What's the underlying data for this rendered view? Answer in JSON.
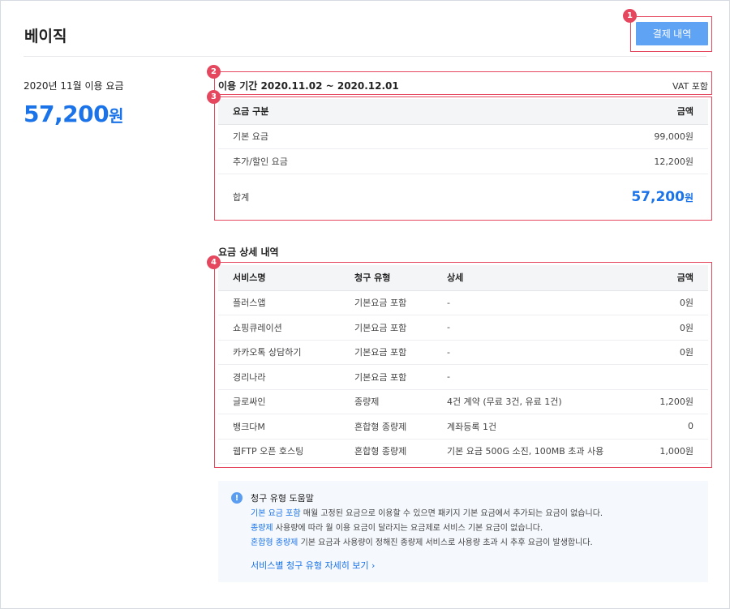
{
  "header": {
    "plan_name": "베이직",
    "pay_history_button": "결제 내역"
  },
  "summary": {
    "usage_label": "2020년 11월 이용 요금",
    "usage_amount": "57,200",
    "usage_unit": "원"
  },
  "period": {
    "label": "이용 기간 2020.11.02 ~ 2020.12.01",
    "vat": "VAT 포함"
  },
  "fee_table": {
    "headers": {
      "type": "요금 구분",
      "amount": "금액"
    },
    "rows": [
      {
        "name": "기본 요금",
        "amount": "99,000원"
      },
      {
        "name": "추가/할인 요금",
        "amount": "12,200원"
      }
    ],
    "total_label": "합계",
    "total_amount": "57,200",
    "total_unit": "원"
  },
  "detail": {
    "title": "요금 상세 내역",
    "headers": {
      "service": "서비스명",
      "billing_type": "청구 유형",
      "detail": "상세",
      "amount": "금액"
    },
    "rows": [
      {
        "service": "플러스앱",
        "billing_type": "기본요금 포함",
        "detail": "-",
        "amount": "0원"
      },
      {
        "service": "쇼핑큐레이션",
        "billing_type": "기본요금 포함",
        "detail": "-",
        "amount": "0원"
      },
      {
        "service": "카카오톡 상담하기",
        "billing_type": "기본요금 포함",
        "detail": "-",
        "amount": "0원"
      },
      {
        "service": "경리나라",
        "billing_type": "기본요금 포함",
        "detail": "-",
        "amount": ""
      },
      {
        "service": "글로싸인",
        "billing_type": "종량제",
        "detail": "4건 계약 (무료 3건, 유료 1건)",
        "amount": "1,200원"
      },
      {
        "service": "뱅크다M",
        "billing_type": "혼합형 종량제",
        "detail": "계좌등록 1건",
        "amount": "0"
      },
      {
        "service": "웹FTP 오픈 호스팅",
        "billing_type": "혼합형 종량제",
        "detail": "기본 요금 500G 소진, 100MB 초과 사용",
        "amount": "1,000원"
      }
    ]
  },
  "help": {
    "icon": "info-icon",
    "icon_glyph": "!",
    "title": "청구 유형 도움말",
    "lines": [
      {
        "key": "기본 요금 포함",
        "text": " 매월 고정된 요금으로 이용할 수 있으면 패키지 기본 요금에서 추가되는 요금이 없습니다."
      },
      {
        "key": "종량제",
        "text": " 사용량에 따라 월 이용 요금이 달라지는 요금제로 서비스 기본 요금이 없습니다."
      },
      {
        "key": "혼합형 종량제",
        "text": " 기본 요금과 사용량이 정해진 종량제 서비스로 사용량 초과 시 추후 요금이 발생합니다."
      }
    ],
    "link": "서비스별 청구 유형 자세히 보기 ›"
  },
  "annotations": [
    "1",
    "2",
    "3",
    "4"
  ],
  "colors": {
    "accent": "#1a73e8",
    "button": "#5fa3f5",
    "annotation": "#e5475e"
  }
}
